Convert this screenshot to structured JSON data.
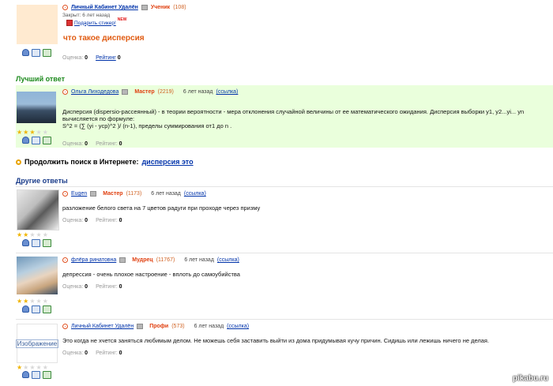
{
  "question": {
    "author": "Личный Кабинет Удалён",
    "rank": "Ученик",
    "points": "(108)",
    "status": "Закрыт: 6 лет назад",
    "sticker": "Подарить стикер!",
    "sticker_badge": "NEW",
    "title": "что такое дисперсия",
    "rating_label": "Оценка:",
    "rating_value": "0",
    "score_label": "Рейтинг",
    "score_value": "0"
  },
  "best_answer": {
    "section_title": "Лучший ответ",
    "author": "Ольга Лиходедова",
    "rank": "Мастер",
    "points": "(2219)",
    "time": "6 лет назад",
    "link": "(ссылка)",
    "text1": "Дисперсия (dispersio-рассеянный) - в теории вероятности - мера отклонения случайной величины от ее математического ожидания. Дисперсия выборки y1, y2...yi... yn",
    "text2": "вычисляется по формуле:",
    "text3": "S^2 = (∑ (yi - ycp)^2 )/ (n-1), пределы суммирования от1 до n .",
    "rating_label": "Оценка:",
    "rating_value": "0",
    "score_label": "Рейтинг:",
    "score_value": "0",
    "stars": 3
  },
  "search": {
    "label": "Продолжить поиск в Интернете:",
    "query": "дисперсия это"
  },
  "other_answers": {
    "section_title": "Другие ответы",
    "items": [
      {
        "author": "Eugen",
        "rank": "Мастер",
        "points": "(1173)",
        "time": "6 лет назад",
        "link": "(ссылка)",
        "text": "разложение белого света на 7 цветов радуги при проходе через призму",
        "rating_label": "Оценка:",
        "rating_value": "0",
        "score_label": "Рейтинг:",
        "score_value": "0",
        "stars": 2
      },
      {
        "author": "флёра ринатовна",
        "rank": "Мудрец",
        "points": "(11767)",
        "time": "6 лет назад",
        "link": "(ссылка)",
        "text": "депрессия - очень плохое настроение - вплоть до самоубийства",
        "rating_label": "Оценка:",
        "rating_value": "0",
        "score_label": "Рейтинг:",
        "score_value": "0",
        "stars": 2
      },
      {
        "author": "Личный Кабинет Удалён",
        "rank": "Профи",
        "points": "(573)",
        "time": "6 лет назад",
        "link": "(ссылка)",
        "avatar_text": "Изображение",
        "text": "Это когда не хчется заняться любимым делом. Не можешь себя заставить выйти из дома придумывая кучу причин. Сидишь или лежишь ничего не делая.",
        "rating_label": "Оценка:",
        "rating_value": "0",
        "score_label": "Рейтинг:",
        "score_value": "0",
        "stars": 1
      }
    ]
  },
  "watermark": "pikabu.ru"
}
